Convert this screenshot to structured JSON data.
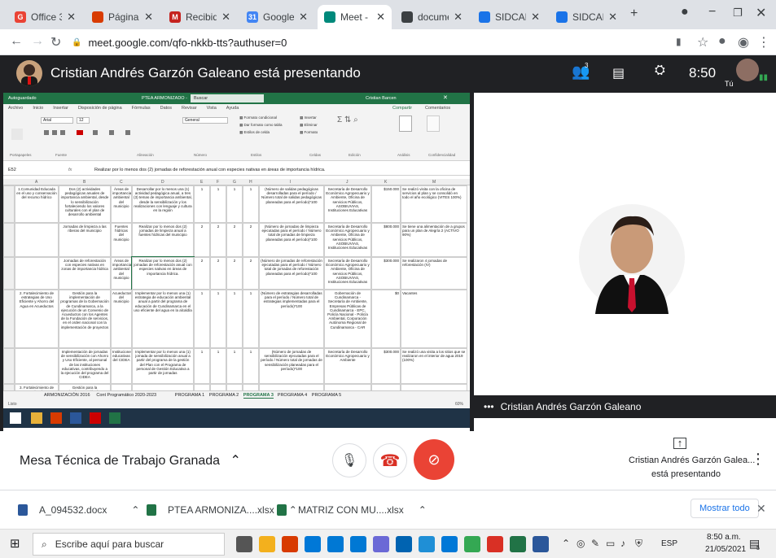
{
  "browser": {
    "tabs": [
      {
        "label": "Office 365 - E",
        "color": "#ea4335",
        "letter": "G"
      },
      {
        "label": "Página princip",
        "color": "#d83b01",
        "letter": ""
      },
      {
        "label": "Recibidos (68",
        "color": "#c5221f",
        "letter": "M"
      },
      {
        "label": "Google Calen",
        "color": "#4285f4",
        "letter": "31"
      },
      {
        "label": "Meet - M",
        "color": "#00897b",
        "letter": "",
        "active": true
      },
      {
        "label": "document (7",
        "color": "#3c4043",
        "letter": ""
      },
      {
        "label": "SIDCAR - Ges",
        "color": "#1a73e8",
        "letter": ""
      },
      {
        "label": "SIDCAR - Ges",
        "color": "#1a73e8",
        "letter": ""
      }
    ],
    "new_tab": "+",
    "url": "meet.google.com/qfo-nkkb-tts?authuser=0"
  },
  "meet": {
    "presenting_title": "Cristian Andrés Garzón Galeano está presentando",
    "participants_count": "3",
    "clock": "8:50",
    "you_label": "Tú",
    "presenter_name": "Cristian Andrés Garzón Galeano",
    "meeting_name": "Mesa Técnica de Trabajo Granada",
    "presenting_card_line1": "Cristian Andrés Garzón Galea...",
    "presenting_card_line2": "está presentando"
  },
  "excel": {
    "title_left": "Autoguardado",
    "file_name": "PTEA ARMONIZADO -",
    "search_placeholder": "Buscar",
    "user": "Cristian Barcen",
    "menu": [
      "Archivo",
      "Inicio",
      "Insertar",
      "Disposición de página",
      "Fórmulas",
      "Datos",
      "Revisar",
      "Vista",
      "Ayuda"
    ],
    "share": "Compartir",
    "comments": "Comentarios",
    "ribbon_groups": [
      "Portapapeles",
      "Fuente",
      "Alineación",
      "Número",
      "Estilos",
      "Celdas",
      "Edición",
      "Análisis",
      "Confidencialidad"
    ],
    "font_name": "Arial",
    "font_size": "12",
    "number_format": "General",
    "cell_ref": "E52",
    "formula": "Realizar por lo menos dos (2) jornadas de reforestación anual con especies nativas en áreas de importancia hídrica.",
    "sheet_tabs": [
      "ARMONIZACIÓN 2016",
      "Cont Programático 2020-2023",
      "PROGRAMA 1",
      "PROGRAMA 2",
      "PROGRAMA 3",
      "PROGRAMA 4",
      "PROGRAMA 5"
    ],
    "active_sheet": "PROGRAMA 3",
    "status_left": "Listo",
    "zoom": "60%",
    "rows": [
      {
        "a": "1.Comunidad Educada en el uso y conservación del recurso hídrico",
        "b": "Dos (2) actividades pedagógicas anuales de importancia ambiental, desde lo sensibilización fortaleciendo los valores culturales con el plan de desarrollo ambiental",
        "c": "Áreas de importancia ambiental del municipio",
        "d": "Desarrollar por lo menos una (1) actividad pedagógica anual, a tres (3) temas de importancia ambiental, desde la sensibilización y los realizaciones con lenguaje y cultura en la región",
        "e": "1",
        "f": "1",
        "g": "1",
        "h": "1",
        "i": "(Número de salidas pedagógicas desarrolladas para el período / Número total de salidas pedagógicas planeadas para el período)*100",
        "j": "Secretaría de Desarrollo Económico Agropecuario y Ambiente, Oficina de servicios Públicos, ASOBIUVIAS, Instituciones Educativas",
        "k": "$150.000",
        "m": "Se realizó visita con la oficina de servicios al plan y se consolidó en todo el año ecológico (VITES 100%)"
      },
      {
        "a": "",
        "b": "Jornadas de limpieza a las riberas del municipio",
        "c": "Fuentes hídricas del municipio",
        "d": "Realizar por lo menos dos (2) jornadas de limpieza anual a fuentes hídricas del municipio",
        "e": "2",
        "f": "2",
        "g": "2",
        "h": "2",
        "i": "(Número de jornadas de limpieza ejecutadas para el período / Número total de jornadas de limpieza planeadas para el período)*100",
        "j": "Secretaría de Desarrollo Económico Agropecuario y Ambiente, Oficina de servicios Públicos, ASOBIUVIAS, Instituciones Educativas",
        "k": "$800.000",
        "m": "Se tiene una alimentación de a grupos para un plan de Alegría 2 (ACTIVO 90%)"
      },
      {
        "a": "",
        "b": "Jornadas de reforestación con especies nativas en zonas de importancia hídrica",
        "c": "Áreas de importancia ambiental del municipio",
        "d": "Realizar por lo menos dos (2) jornadas de reforestación anual con especies nativas en áreas de importancia hídrica.",
        "e": "2",
        "f": "2",
        "g": "2",
        "h": "2",
        "i": "(Número de jornadas de reforestación ejecutadas para el período / Número total de jornadas de reforestación planeadas para el período)*100",
        "j": "Secretaría de Desarrollo Económico Agropecuario y Ambiente, Oficina de servicios Públicos, ASOBIUVIAS, Instituciones Educativas",
        "k": "$300.000",
        "m": "Se realizaron 4 jornadas de reforestación (IV)"
      },
      {
        "a": "2. Fortalecimiento de estrategias de Uso Eficiente y Ahorro del Agua en Acueductos",
        "b": "Gestión para la implementación de programas de la Gobernación de Cundinamarca, a la ejecución de un Convenio de Acueductos con los Agentes de la Fundación de servicios, en el orden nacional con la implementación de proyectos",
        "c": "Acueductos del municipio",
        "d": "Implementar por lo menos una (1) estrategia de educación ambiental anual a partir del programa de educación de Cundinamarca en el uso eficiente del agua en la alcaldía",
        "e": "1",
        "f": "1",
        "g": "1",
        "h": "1",
        "i": "(Número de estrategias desarrolladas para el período / Número total de estrategias implementadas para el período)*100",
        "j": "Gobernación de Cundinamarca - Secretaría de Ambiente, Empresas Públicas de Cundinamarca - EPC, Policía Nacional - Policía Ambiental, Corporación Autónoma Regional de Cundinamarca - CAR",
        "k": "$0",
        "m": "Vacantes"
      },
      {
        "a": "",
        "b": "Implementación de jornadas de sensibilización con Ahorro y Uso Eficiente, al personal de las instituciones educativas, contribuyendo a la ejecución del programa del CIDEA",
        "c": "Instituciones educativas del CIDEA",
        "d": "Implementar por lo menos una (1) jornada de sensibilización anual a partir del programa de la gestión del Plan con el Programa de personal de Gestión Educativa a partir de jornadas",
        "e": "1",
        "f": "1",
        "g": "1",
        "h": "1",
        "i": "(Número de jornadas de sensibilización ejecutadas para el período / Número total de jornadas de sensibilización planeadas para el período)*100",
        "j": "Secretaría de Desarrollo Económico Agropecuario y Ambiente",
        "k": "$300.000",
        "m": "Se realizó una visita a los sitios que se realizaron en el interior de agua 2019 (100%)"
      },
      {
        "a": "3. Fortalecimiento de estrategias de Uso Eficiente",
        "b": "Gestión para la implementación de programas",
        "c": "",
        "d": "",
        "e": "",
        "f": "",
        "g": "",
        "h": "",
        "i": "",
        "j": "",
        "k": "",
        "m": ""
      }
    ]
  },
  "downloads": {
    "items": [
      "A_094532.docx",
      "PTEA ARMONIZA....xlsx",
      "MATRIZ CON MU....xlsx"
    ],
    "show_all": "Mostrar todo"
  },
  "taskbar": {
    "search_placeholder": "Escribe aquí para buscar",
    "lang": "ESP",
    "time": "8:50 a.m.",
    "date": "21/05/2021",
    "badge": "5"
  }
}
